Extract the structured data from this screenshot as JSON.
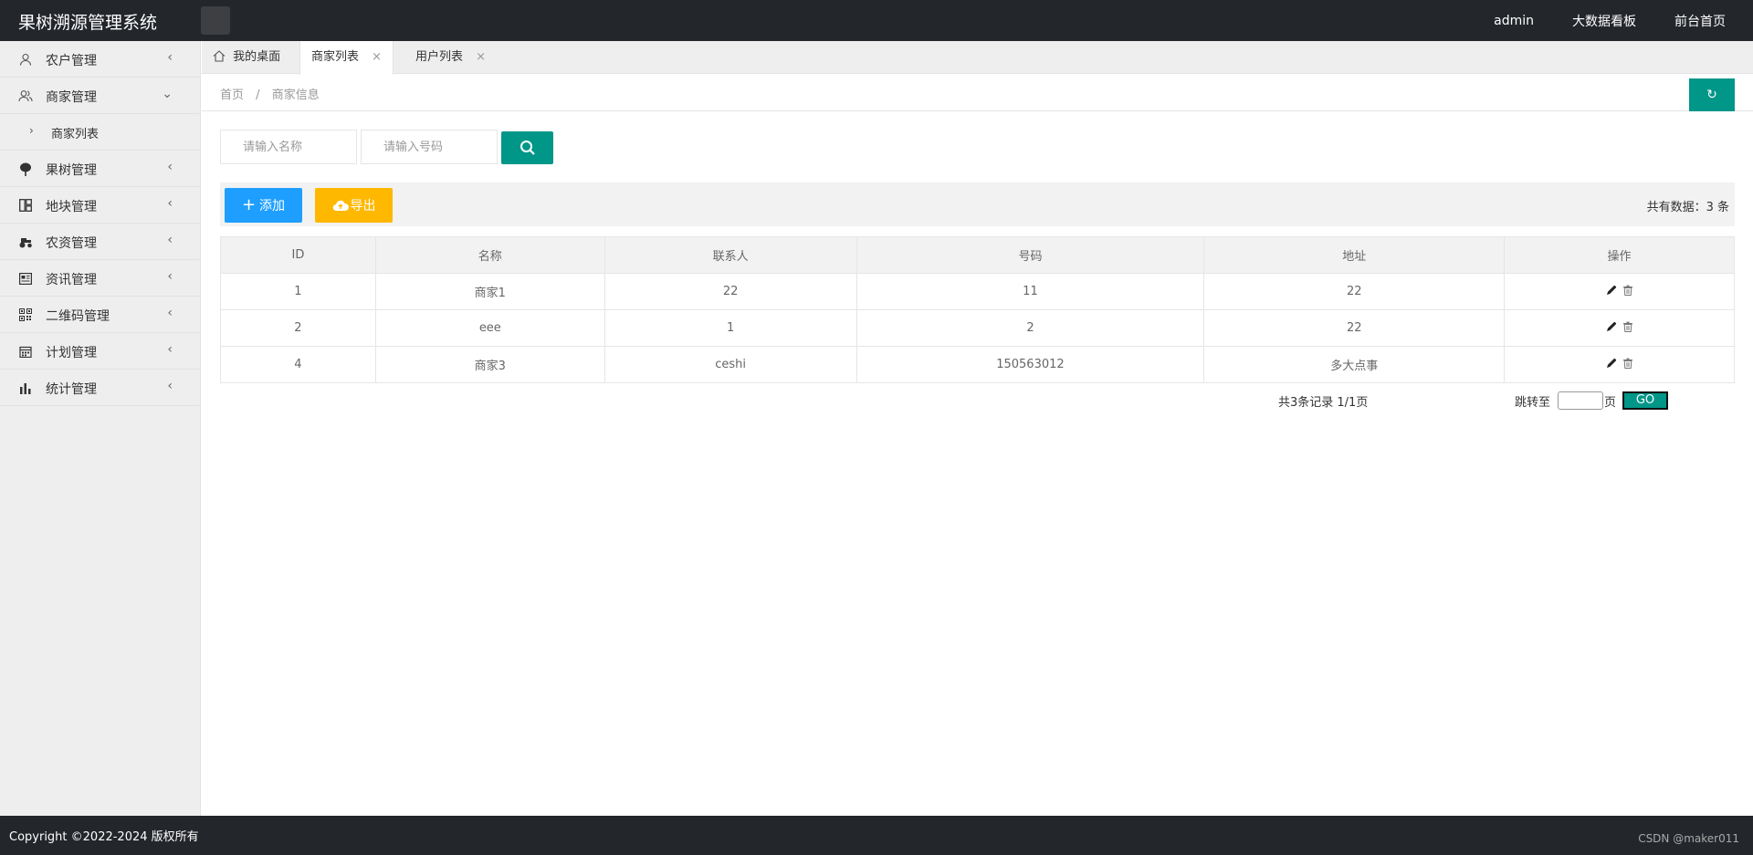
{
  "app": {
    "title": "果树溯源管理系统"
  },
  "header": {
    "nav": [
      "admin",
      "大数据看板",
      "前台首页"
    ]
  },
  "sidebar": {
    "items": [
      {
        "label": "农户管理",
        "icon": "user-icon",
        "arrow": "‹"
      },
      {
        "label": "商家管理",
        "icon": "users-icon",
        "arrow": "⌄"
      },
      {
        "label": "果树管理",
        "icon": "tree-icon",
        "arrow": "‹"
      },
      {
        "label": "地块管理",
        "icon": "grid-icon",
        "arrow": "‹"
      },
      {
        "label": "农资管理",
        "icon": "tractor-icon",
        "arrow": "‹"
      },
      {
        "label": "资讯管理",
        "icon": "news-icon",
        "arrow": "‹"
      },
      {
        "label": "二维码管理",
        "icon": "qrcode-icon",
        "arrow": "‹"
      },
      {
        "label": "计划管理",
        "icon": "plan-icon",
        "arrow": "‹"
      },
      {
        "label": "统计管理",
        "icon": "bar-chart-icon",
        "arrow": "‹"
      }
    ],
    "sub_items": [
      {
        "label": "商家列表",
        "arrow": "›"
      }
    ]
  },
  "tabs": [
    {
      "label": "我的桌面",
      "icon": "home-icon",
      "closable": false
    },
    {
      "label": "商家列表",
      "closable": true,
      "active": true
    },
    {
      "label": "用户列表",
      "closable": true
    }
  ],
  "tab_close": "×",
  "breadcrumb": {
    "items": [
      "首页",
      "商家信息"
    ],
    "separator": "/"
  },
  "refresh_icon": "↻",
  "search": {
    "name_placeholder": "请输入名称",
    "phone_placeholder": "请输入号码"
  },
  "toolbar": {
    "add_label": "添加",
    "export_label": "导出",
    "count_text": "共有数据：3 条"
  },
  "table": {
    "columns": [
      "ID",
      "名称",
      "联系人",
      "号码",
      "地址",
      "操作"
    ],
    "rows": [
      [
        "1",
        "商家1",
        "22",
        "11",
        "22"
      ],
      [
        "2",
        "eee",
        "1",
        "2",
        "22"
      ],
      [
        "4",
        "商家3",
        "ceshi",
        "150563012",
        "多大点事"
      ]
    ]
  },
  "pagination": {
    "info": "共3条记录  1/1页",
    "jump_label": "跳转至",
    "page_label": "页",
    "go_label": "GO"
  },
  "footer": {
    "copyright": "Copyright ©2022-2024 版权所有",
    "watermark": "CSDN @maker011"
  },
  "colors": {
    "header_bg": "#23262b",
    "primary_green": "#009688",
    "add_blue": "#1e9fff",
    "export_yellow": "#ffb800"
  }
}
